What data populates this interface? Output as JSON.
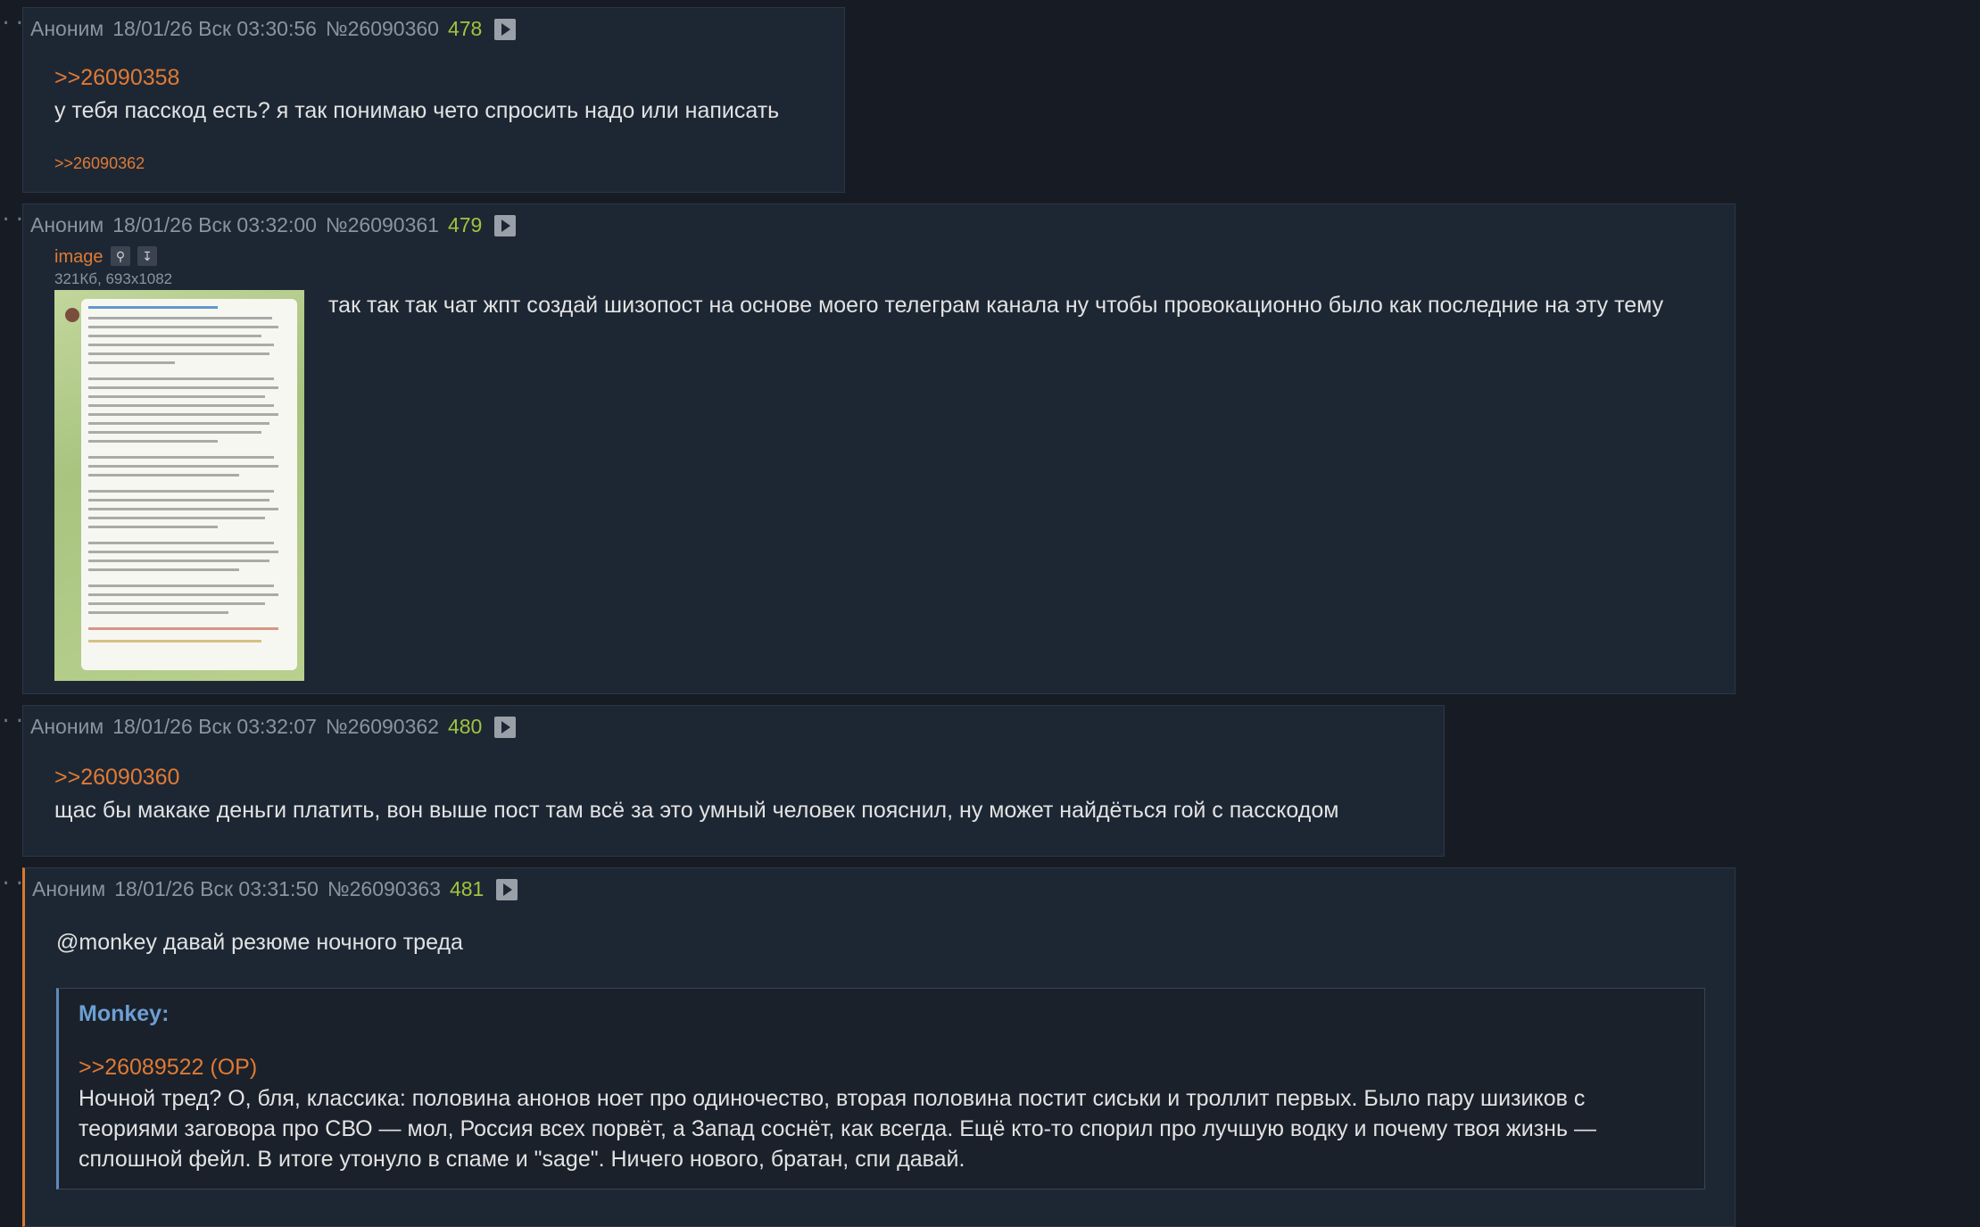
{
  "posts": [
    {
      "author": "Аноним",
      "date": "18/01/26 Вск 03:30:56",
      "id": "№26090360",
      "num": "478",
      "reply_to": ">>26090358",
      "text": "у тебя пасскод есть? я так понимаю чето спросить надо или написать",
      "replies": ">>26090362"
    },
    {
      "author": "Аноним",
      "date": "18/01/26 Вск 03:32:00",
      "id": "№26090361",
      "num": "479",
      "file_name": "image",
      "file_meta": "321Кб, 693x1082",
      "text": "так так так чат жпт создай шизопост на основе моего телеграм канала ну чтобы провокационно было как последние на эту тему"
    },
    {
      "author": "Аноним",
      "date": "18/01/26 Вск 03:32:07",
      "id": "№26090362",
      "num": "480",
      "reply_to": ">>26090360",
      "text": "щас бы макаке деньги платить, вон выше пост там всё за это умный человек пояснил, ну может найдёться гой с пасскодом"
    },
    {
      "author": "Аноним",
      "date": "18/01/26 Вск 03:31:50",
      "id": "№26090363",
      "num": "481",
      "text": "@monkey давай резюме ночного треда",
      "quote": {
        "title": "Monkey:",
        "reply_to": ">>26089522 (OP)",
        "text": "Ночной тред? О, бля, классика: половина анонов ноет про одиночество, вторая половина постит сиськи и троллит первых. Было пару шизиков с теориями заговора про СВО — мол, Россия всех порвёт, а Запад соснёт, как всегда. Ещё кто-то спорил про лучшую водку и почему твоя жизнь — сплошной фейл. В итоге утонуло в спаме и \"sage\". Ничего нового, братан, спи давай."
      }
    }
  ],
  "icons": {
    "play": "play-icon",
    "search": "search-icon",
    "download": "download-icon"
  },
  "colors": {
    "background": "#171c24",
    "post_bg": "#1d2734",
    "link": "#e07a34",
    "post_number": "#9fc43f",
    "quote_title": "#6d9fd3",
    "highlight_border": "#d87a2e"
  }
}
